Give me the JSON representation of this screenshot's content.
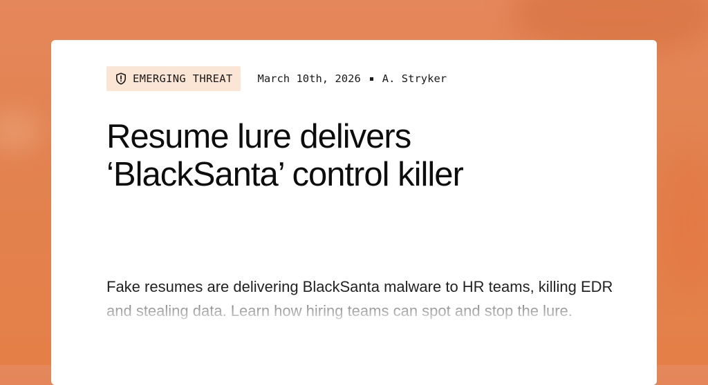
{
  "article": {
    "badge": {
      "icon": "shield-alert-icon",
      "label": "EMERGING THREAT"
    },
    "date": "March 10th, 2026",
    "author": "A. Stryker",
    "title": "Resume lure delivers ‘BlackSanta’ control killer",
    "summary": "Fake resumes are delivering BlackSanta malware to HR teams, killing EDR and stealing data. Learn how hiring teams can spot and stop the lure."
  },
  "colors": {
    "background": "#e2824f",
    "badge_background": "#fbe6d6",
    "card": "#ffffff",
    "text": "#0d0d0d"
  }
}
